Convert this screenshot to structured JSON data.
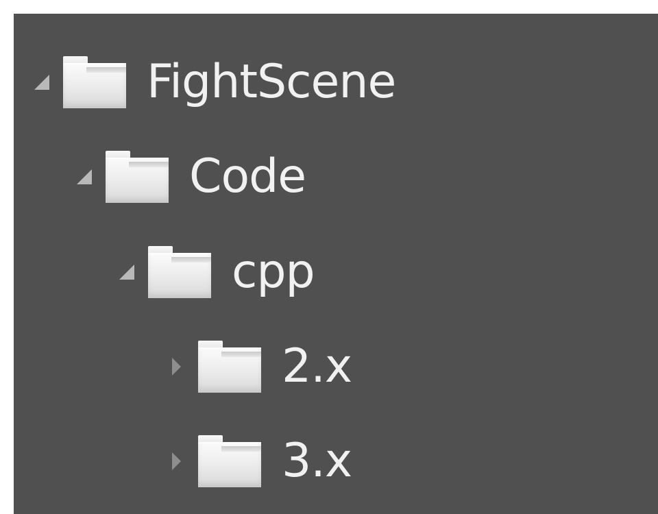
{
  "tree": {
    "items": [
      {
        "label": "FightScene",
        "state": "expanded",
        "level": 0
      },
      {
        "label": "Code",
        "state": "expanded",
        "level": 1
      },
      {
        "label": "cpp",
        "state": "expanded",
        "level": 2
      },
      {
        "label": "2.x",
        "state": "collapsed",
        "level": 3
      },
      {
        "label": "3.x",
        "state": "collapsed",
        "level": 3
      }
    ]
  },
  "icons": {
    "expanded": "expanded-arrow-icon",
    "collapsed": "collapsed-arrow-icon",
    "folder": "folder-icon"
  },
  "colors": {
    "background": "#505050",
    "text": "#f1f1f1",
    "folder": "#eeeeee",
    "arrow_expanded": "#b9b9b9",
    "arrow_collapsed": "#8e8e8e"
  }
}
